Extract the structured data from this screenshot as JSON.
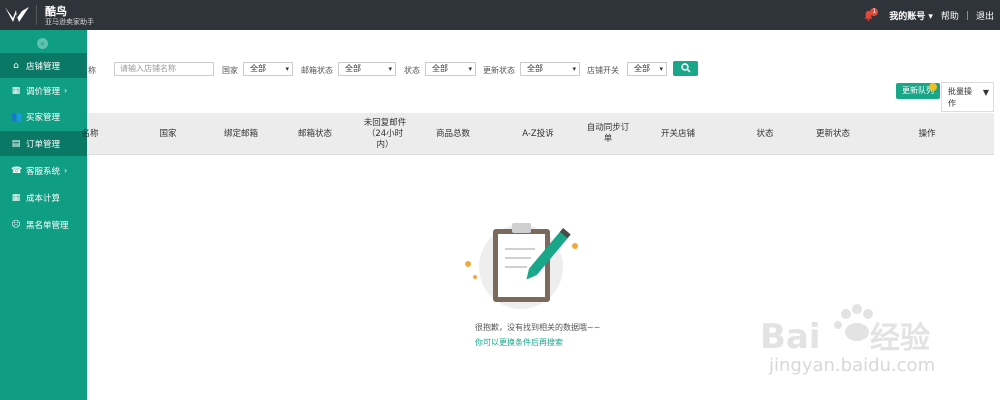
{
  "header": {
    "brand": "酷鸟",
    "subtitle": "亚马逊卖家助手",
    "notif_count": "1",
    "account": "我的账号",
    "help": "帮助",
    "separator": "|",
    "logout": "退出"
  },
  "sidebar": {
    "collapse_icon": "«",
    "items": [
      {
        "label": "店铺管理",
        "icon": "home-icon"
      },
      {
        "label": "调价管理",
        "icon": "chart-icon",
        "chevron": "›"
      },
      {
        "label": "买家管理",
        "icon": "users-icon"
      },
      {
        "label": "订单管理",
        "icon": "doc-icon"
      },
      {
        "label": "客服系统",
        "icon": "phone-icon",
        "chevron": "›"
      },
      {
        "label": "成本计算",
        "icon": "calc-icon"
      },
      {
        "label": "黑名单管理",
        "icon": "user-block-icon"
      }
    ]
  },
  "filters": {
    "truncated_label": "称",
    "store_name_placeholder": "请输入店铺名称",
    "country_label": "国家",
    "country_value": "全部",
    "email_status_label": "邮箱状态",
    "email_status_value": "全部",
    "status_label": "状态",
    "status_value": "全部",
    "update_status_label": "更新状态",
    "update_status_value": "全部",
    "store_switch_label": "店铺开关",
    "store_switch_value": "全部",
    "caret": "▾"
  },
  "actions": {
    "update_queue": "更新队列",
    "batch_line1": "批量操",
    "batch_line2": "作"
  },
  "table": {
    "headers": [
      "名称",
      "国家",
      "绑定邮箱",
      "邮箱状态",
      "未回复邮件\n（24小时\n内）",
      "商品总数",
      "A-Z投诉",
      "自动同步订\n单",
      "开关店铺",
      "状态",
      "更新状态",
      "操作"
    ]
  },
  "empty": {
    "message": "很抱歉，没有找到相关的数据哦~~",
    "link": "你可以更换条件后再搜索"
  },
  "watermark": {
    "text": "jingyan.baidu.com"
  },
  "colors": {
    "topbar": "#2f343a",
    "sidebar": "#0f9e84",
    "sidebar_active": "#0b7865",
    "accent": "#1aa689"
  }
}
